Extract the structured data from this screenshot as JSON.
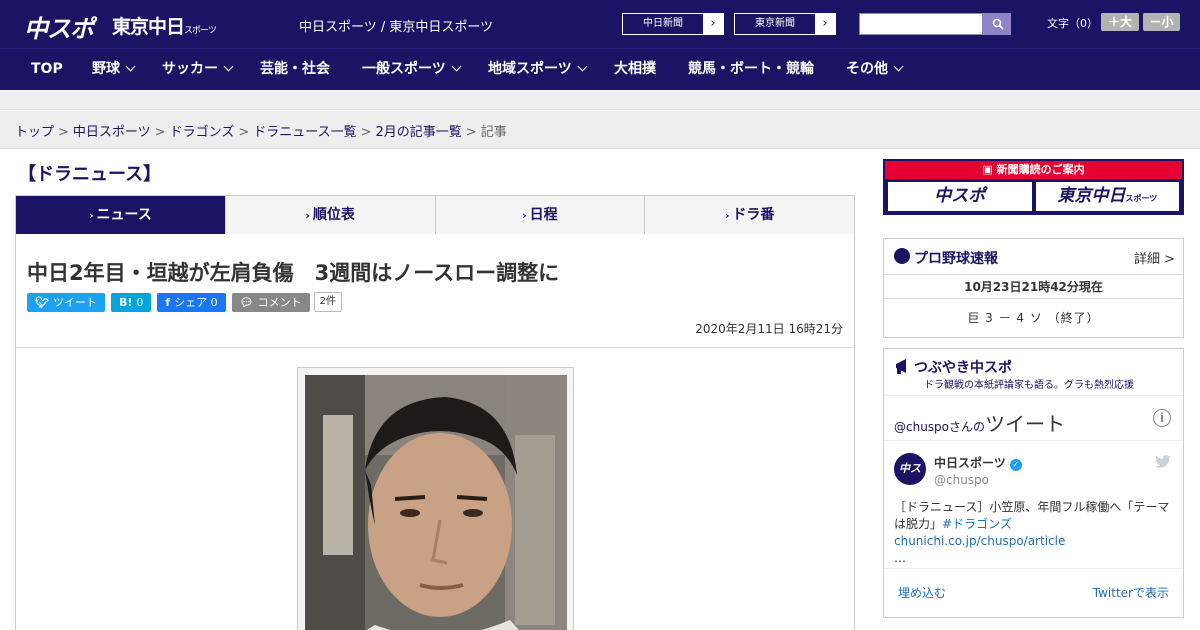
{
  "header": {
    "logo_chuspo": "中スポ",
    "logo_tokyo": "東京中日",
    "logo_tokyo_small": "スポーツ",
    "site_link": "中日スポーツ / 東京中日スポーツ",
    "paper_buttons": [
      {
        "label": "中日新聞"
      },
      {
        "label": "東京新聞"
      }
    ],
    "search_placeholder": "",
    "font_size_label": "文字（0）",
    "font_plus": "＋大",
    "font_minus": "－小"
  },
  "nav": {
    "items": [
      {
        "label": "TOP",
        "dropdown": false
      },
      {
        "label": "野球",
        "dropdown": true
      },
      {
        "label": "サッカー",
        "dropdown": true
      },
      {
        "label": "芸能・社会",
        "dropdown": false
      },
      {
        "label": "一般スポーツ",
        "dropdown": true
      },
      {
        "label": "地域スポーツ",
        "dropdown": true
      },
      {
        "label": "大相撲",
        "dropdown": false
      },
      {
        "label": "競馬・ボート・競輪",
        "dropdown": false
      },
      {
        "label": "その他",
        "dropdown": true
      }
    ]
  },
  "breadcrumb": {
    "items": [
      "トップ",
      "中日スポーツ",
      "ドラゴンズ",
      "ドラニュース一覧",
      "2月の記事一覧"
    ],
    "current": "記事",
    "separator": ">"
  },
  "section": {
    "title": "【ドラニュース】",
    "tabs": [
      {
        "label": "ニュース",
        "active": true
      },
      {
        "label": "順位表",
        "active": false
      },
      {
        "label": "日程",
        "active": false
      },
      {
        "label": "ドラ番",
        "active": false
      }
    ]
  },
  "article": {
    "headline": "中日2年目・垣越が左肩負傷　3週間はノースロー調整に",
    "share": {
      "tweet_label": "ツイート",
      "hatena_label": "B!",
      "hatena_count": "0",
      "facebook_label": "シェア",
      "facebook_count": "0",
      "comment_label": "コメント",
      "comment_count": "2件"
    },
    "timestamp": "2020年2月11日 16時21分"
  },
  "sidebar": {
    "ad": {
      "title": "新聞購読のご案内",
      "logo1": "中スポ",
      "logo2": "東京中日",
      "logo2_small": "スポーツ"
    },
    "baseball": {
      "title": "プロ野球速報",
      "detail": "詳細 >",
      "as_of": "10月23日21時42分現在",
      "score": "巨 3 － 4 ソ （終了）"
    },
    "tweets": {
      "title": "つぶやき中スポ",
      "subtitle": "ドラ観戦の本紙評論家も語る。グラも熱烈応援",
      "handle": "@chuspo",
      "handle_suffix": "さんの",
      "handle_big": "ツイート",
      "tweet": {
        "name": "中日スポーツ",
        "account": "@chuspo",
        "text": "［ドラニュース］小笠原、年間フル稼働へ「テーマは脱力」",
        "link": "#ドラゴンズchunichi.co.jp/chuspo/article",
        "ellipsis": "…"
      },
      "embed_label": "埋め込む",
      "show_label": "Twitterで表示"
    }
  },
  "colors": {
    "brand": "#1b1464",
    "accent_red": "#e60033",
    "twitter": "#1da1f2",
    "facebook": "#1877f2",
    "hatena": "#00a4de"
  }
}
